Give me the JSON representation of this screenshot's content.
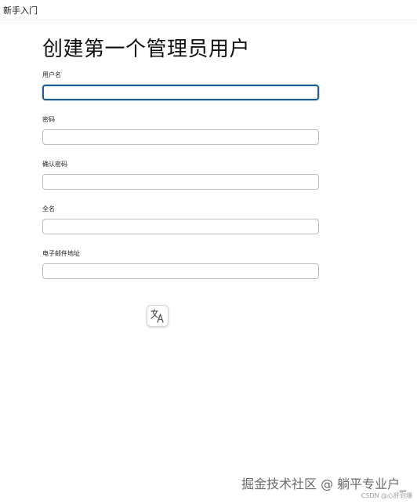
{
  "window": {
    "tab_title": "新手入门"
  },
  "page": {
    "title": "创建第一个管理员用户"
  },
  "form": {
    "fields": [
      {
        "label": "用户名",
        "value": ""
      },
      {
        "label": "密码",
        "value": ""
      },
      {
        "label": "确认密码",
        "value": ""
      },
      {
        "label": "全名",
        "value": ""
      },
      {
        "label": "电子邮件地址",
        "value": ""
      }
    ]
  },
  "overlay": {
    "translate_icon": "translate-icon"
  },
  "watermark": {
    "main_text": "掘金技术社区 @ 躺平专业户_",
    "sub_text": "CSDN @心肝到爆"
  },
  "colors": {
    "focus_border": "#1d5f94",
    "input_border": "#bdbdbd"
  }
}
